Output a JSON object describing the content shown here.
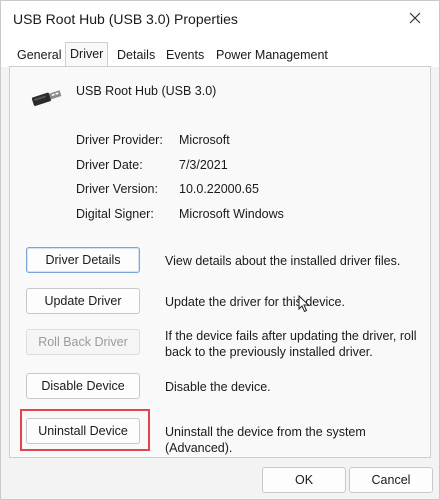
{
  "window": {
    "title": "USB Root Hub (USB 3.0) Properties"
  },
  "tabs": [
    {
      "label": "General"
    },
    {
      "label": "Driver"
    },
    {
      "label": "Details"
    },
    {
      "label": "Events"
    },
    {
      "label": "Power Management"
    }
  ],
  "device": {
    "name": "USB Root Hub (USB 3.0)",
    "icon": "usb-plug-icon"
  },
  "properties": [
    {
      "label": "Driver Provider:",
      "value": "Microsoft"
    },
    {
      "label": "Driver Date:",
      "value": "7/3/2021"
    },
    {
      "label": "Driver Version:",
      "value": "10.0.22000.65"
    },
    {
      "label": "Digital Signer:",
      "value": "Microsoft Windows"
    }
  ],
  "actions": [
    {
      "button": "Driver Details",
      "description": "View details about the installed driver files."
    },
    {
      "button": "Update Driver",
      "description": "Update the driver for this device."
    },
    {
      "button": "Roll Back Driver",
      "description": "If the device fails after updating the driver, roll back to the previously installed driver."
    },
    {
      "button": "Disable Device",
      "description": "Disable the device."
    },
    {
      "button": "Uninstall Device",
      "description": "Uninstall the device from the system (Advanced)."
    }
  ],
  "footer": {
    "ok": "OK",
    "cancel": "Cancel"
  },
  "colors": {
    "highlight": "#e0474c",
    "focus": "#7aa6d8"
  }
}
